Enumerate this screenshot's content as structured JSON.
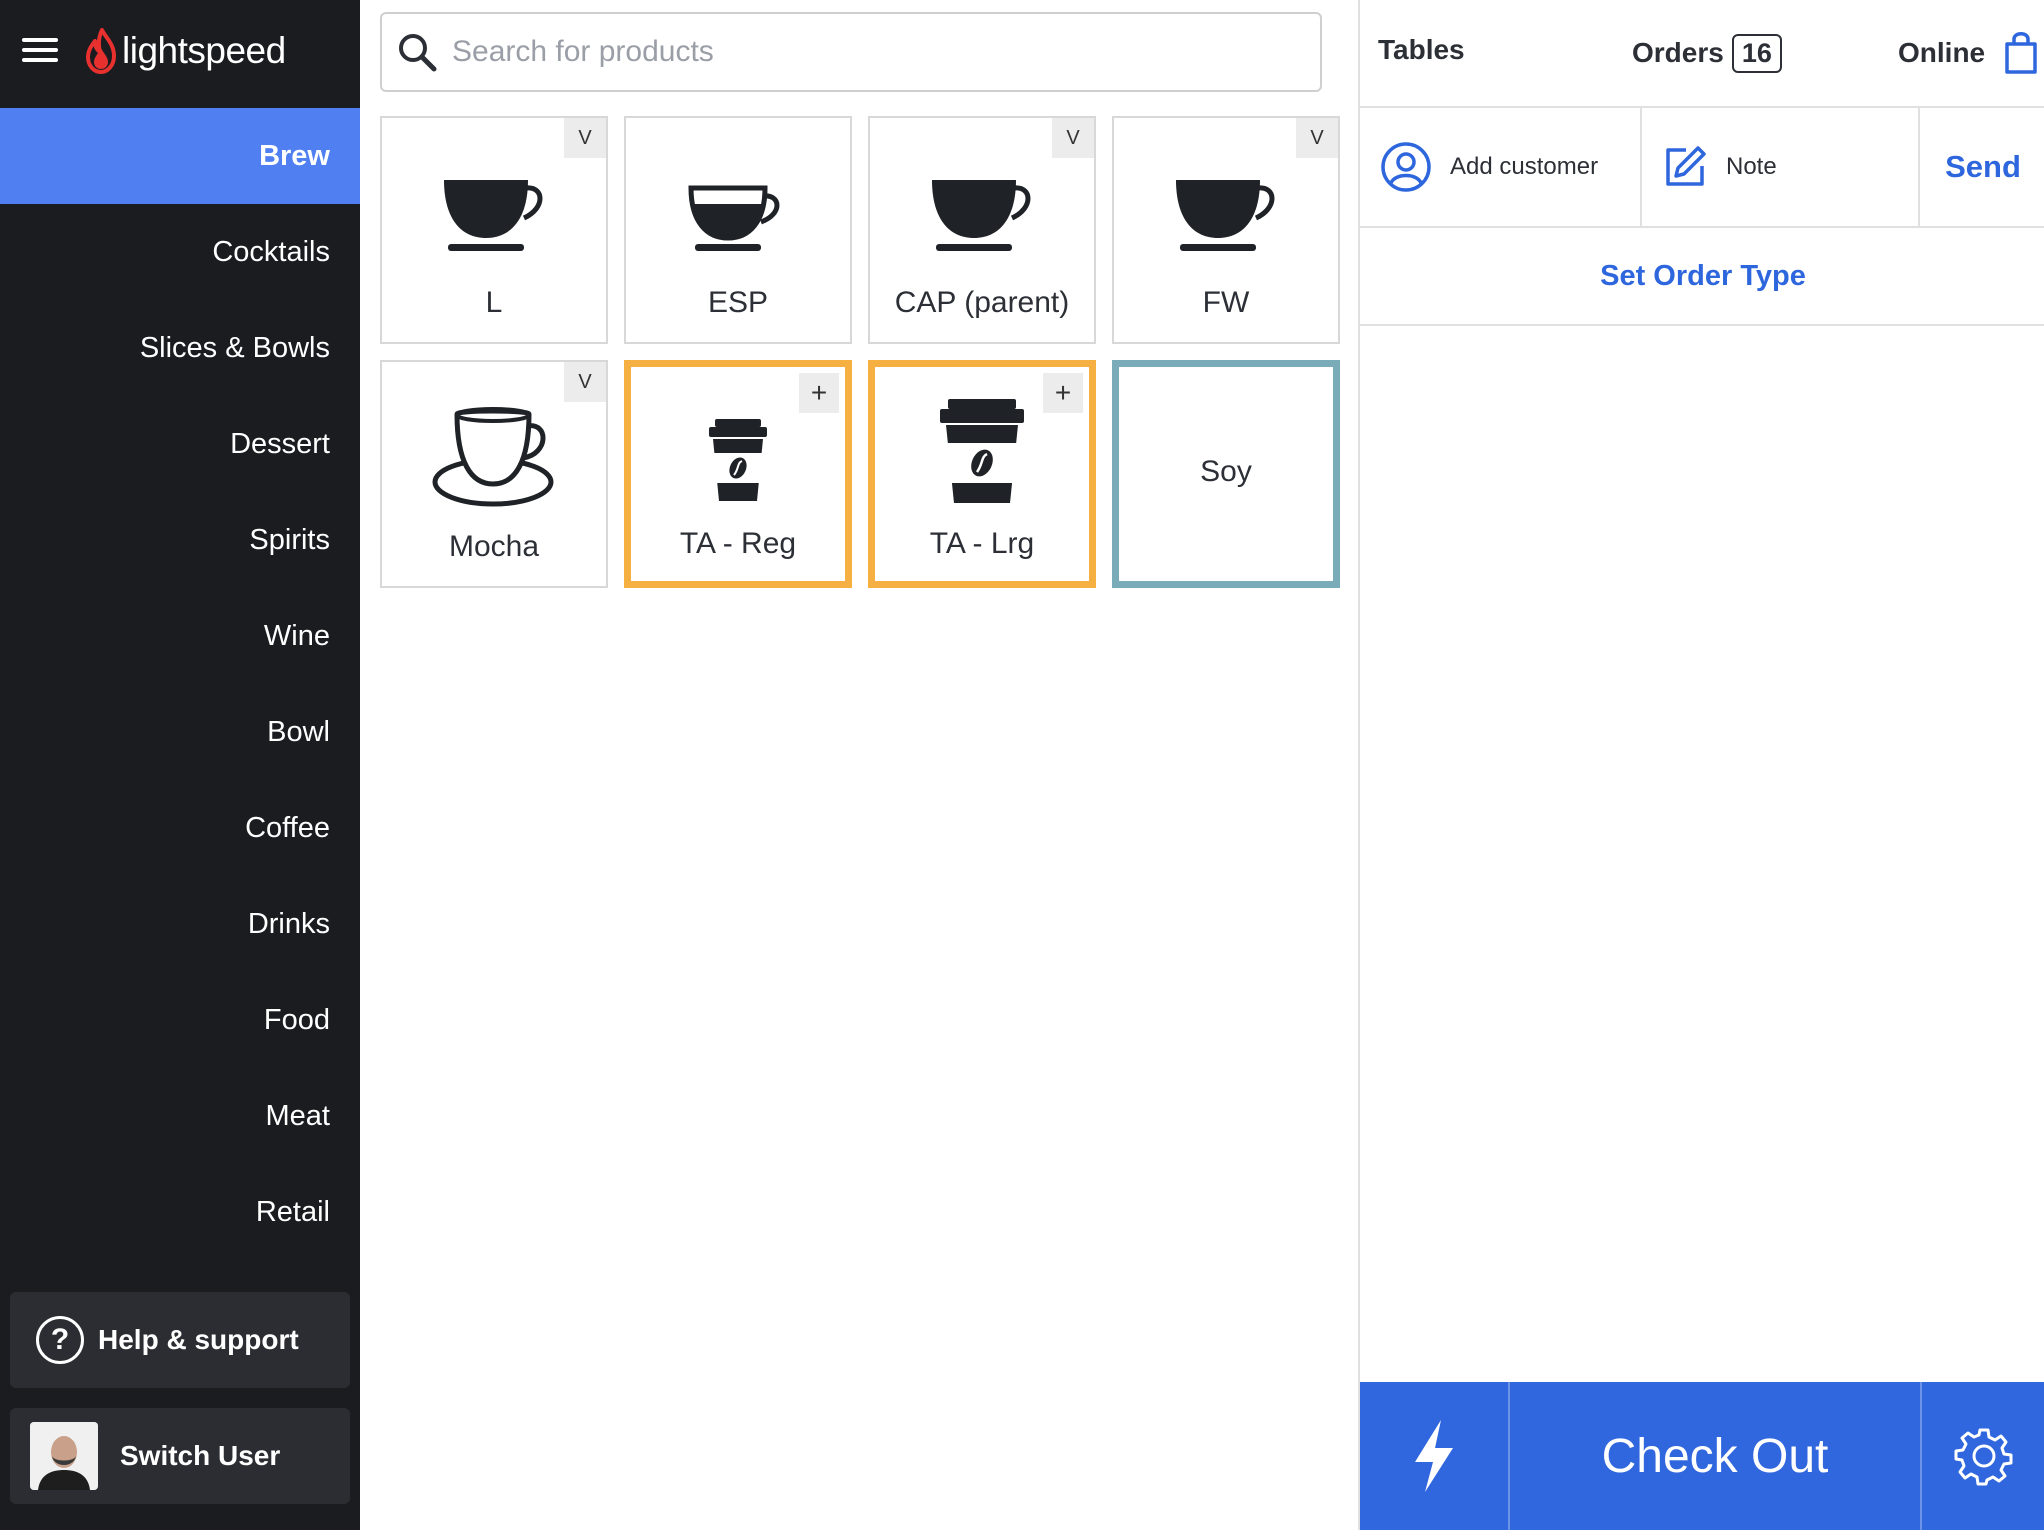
{
  "brand": {
    "name": "lightspeed",
    "icon": "flame-logo-icon",
    "accent": "#e8312f"
  },
  "sidebar": {
    "categories": [
      {
        "label": "Brew",
        "active": true
      },
      {
        "label": "Cocktails"
      },
      {
        "label": "Slices & Bowls"
      },
      {
        "label": "Dessert"
      },
      {
        "label": "Spirits"
      },
      {
        "label": "Wine"
      },
      {
        "label": "Bowl"
      },
      {
        "label": "Coffee"
      },
      {
        "label": "Drinks"
      },
      {
        "label": "Food"
      },
      {
        "label": "Meat"
      },
      {
        "label": "Retail"
      }
    ],
    "help_label": "Help & support",
    "switch_user_label": "Switch User"
  },
  "search": {
    "placeholder": "Search for products",
    "value": ""
  },
  "products": [
    {
      "label": "L",
      "badge": "V",
      "icon": "cup-icon"
    },
    {
      "label": "ESP",
      "icon": "espresso-cup-icon"
    },
    {
      "label": "CAP (parent)",
      "badge": "V",
      "icon": "cup-icon"
    },
    {
      "label": "FW",
      "badge": "V",
      "icon": "cup-icon"
    },
    {
      "label": "Mocha",
      "badge": "V",
      "icon": "outline-cup-icon"
    },
    {
      "label": "TA - Reg",
      "badge": "+",
      "icon": "takeaway-cup-icon",
      "border": "#f5b041"
    },
    {
      "label": "TA - Lrg",
      "badge": "+",
      "icon": "takeaway-cup-large-icon",
      "border": "#f5b041"
    },
    {
      "label": "Soy",
      "border": "#7aabb8"
    }
  ],
  "order_panel": {
    "nav": {
      "tables": "Tables",
      "orders": "Orders",
      "orders_count": "16",
      "online": "Online"
    },
    "add_customer": "Add customer",
    "note": "Note",
    "send": "Send",
    "set_order_type": "Set Order Type",
    "checkout": "Check Out"
  },
  "colors": {
    "sidebar_bg": "#1b1c20",
    "active_category": "#4f7ff0",
    "primary_blue": "#3167de",
    "link_blue": "#2e66dd",
    "tile_orange": "#f5b041",
    "tile_teal": "#7aabb8"
  }
}
